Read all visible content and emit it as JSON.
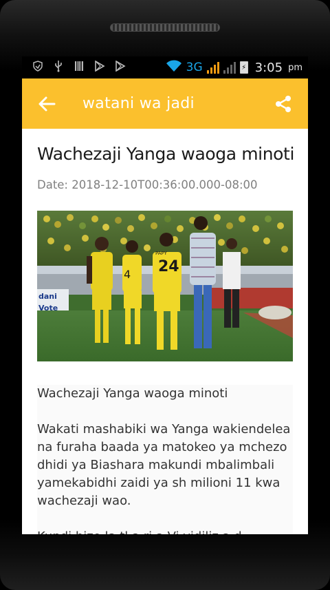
{
  "status_bar": {
    "network": "3G",
    "time": "3:05",
    "ampm": "pm"
  },
  "app_bar": {
    "title": "watani wa jadi",
    "accent_color": "#fbc02d"
  },
  "article": {
    "title": "Wachezaji Yanga waoga minoti",
    "date": "Date: 2018-12-10T00:36:00.000-08:00",
    "image_alt": "Yanga players on the pitch",
    "jersey_number": "24",
    "jersey_name": "PAPY",
    "banner_text_1": "dani",
    "banner_text_2": "Vote",
    "body_heading": "Wachezaji Yanga waoga minoti",
    "body_paragraph": "Wakati mashabiki wa Yanga wakiendelea na furaha baada ya matokeo ya mchezo dhidi ya Biashara makundi mbalimbali yamekabidhi zaidi ya sh milioni 11 kwa wachezaji wao.",
    "body_cutoff": "Kundi hizo la tl a ri a Vi vidiliz a d"
  }
}
